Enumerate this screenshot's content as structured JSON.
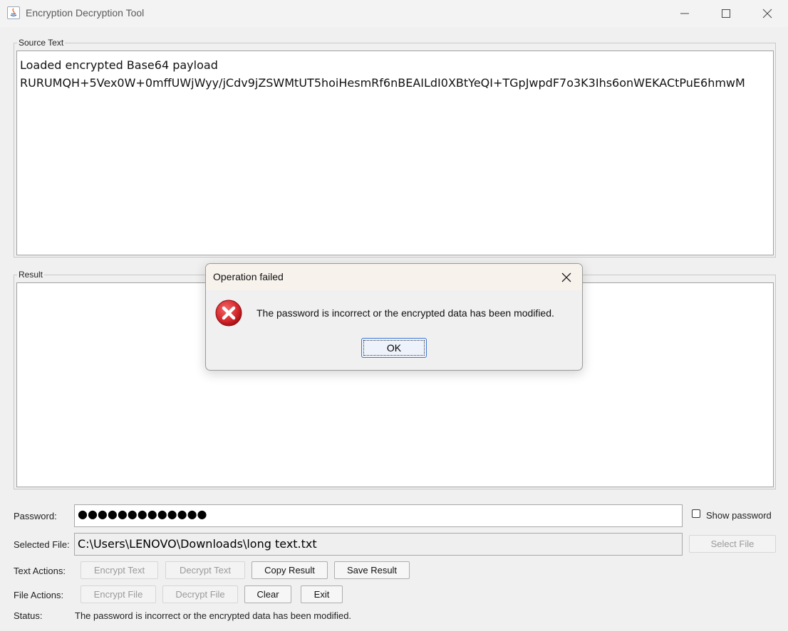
{
  "window": {
    "title": "Encryption Decryption Tool"
  },
  "source": {
    "group_label": "Source Text",
    "line1": "Loaded encrypted Base64 payload",
    "line2": "RURUMQH+5Vex0W+0mffUWjWyy/jCdv9jZSWMtUT5hoiHesmRf6nBEAILdI0XBtYeQI+TGpJwpdF7o3K3Ihs6onWEKACtPuE6hmwM"
  },
  "result": {
    "group_label": "Result",
    "text": ""
  },
  "password": {
    "label": "Password:",
    "masked_value": "●●●●●●●●●●●●●",
    "show_label": "Show password",
    "show_checked": false
  },
  "file": {
    "label": "Selected File:",
    "path": "C:\\Users\\LENOVO\\Downloads\\long text.txt",
    "select_label": "Select File"
  },
  "text_actions": {
    "label": "Text Actions:",
    "encrypt": "Encrypt Text",
    "decrypt": "Decrypt Text",
    "copy": "Copy Result",
    "save": "Save Result"
  },
  "file_actions": {
    "label": "File Actions:",
    "encrypt": "Encrypt File",
    "decrypt": "Decrypt File",
    "clear": "Clear",
    "exit": "Exit"
  },
  "status": {
    "label": "Status:",
    "message": "The password is incorrect or the encrypted data has been modified."
  },
  "dialog": {
    "title": "Operation failed",
    "message": "The password is incorrect or the encrypted data has been modified.",
    "ok_label": "OK",
    "icon": "error-icon"
  },
  "colors": {
    "error_red": "#d6262b",
    "focus_blue": "#3a77d6"
  }
}
